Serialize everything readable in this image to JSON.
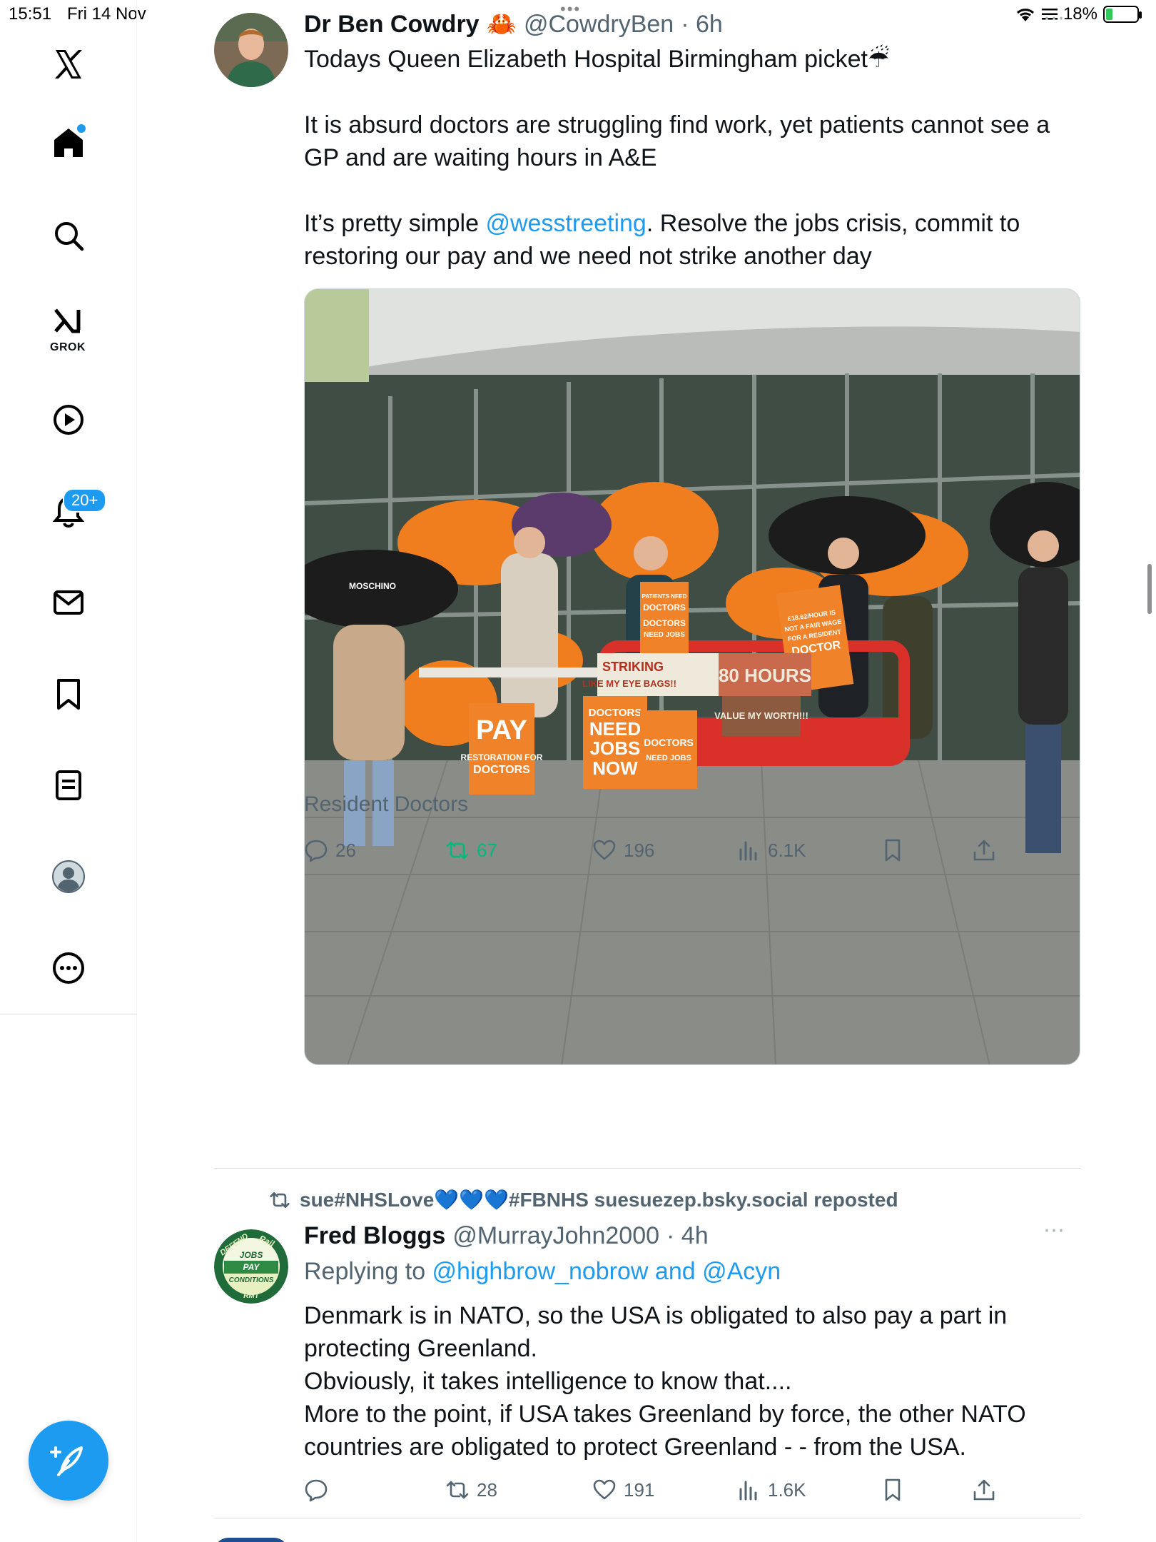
{
  "status_bar": {
    "time": "15:51",
    "date": "Fri 14 Nov",
    "battery": "18%"
  },
  "sidebar": {
    "notifications_badge": "20+",
    "grok_label": "GROK",
    "items": [
      "home-icon",
      "search-icon",
      "grok-icon",
      "video-icon",
      "notifications-icon",
      "messages-icon",
      "bookmarks-icon",
      "lists-icon",
      "profile-icon",
      "more-icon"
    ]
  },
  "tweet1": {
    "name": "Dr Ben Cowdry",
    "emoji": "🦀",
    "handle": "@CowdryBen",
    "time": "· 6h",
    "text_line1": "Todays Queen Elizabeth Hospital Birmingham picket",
    "umbrella": "☔",
    "text_para2": "It is absurd doctors are struggling find work, yet patients cannot see a GP and are waiting hours in A&E",
    "text_para3_pre": "It’s pretty simple ",
    "text_para3_mention": "@wesstreeting",
    "text_para3_post": ". Resolve the jobs crisis, commit to restoring our pay and we need not strike another day",
    "media_caption": "Resident Doctors",
    "media_signs": [
      "PAY",
      "RESTORATION FOR DOCTORS",
      "DOCTORS NEED JOBS NOW",
      "DOCTORS NEED JOBS",
      "PATIENTS NEED DOCTORS",
      "£18.62/HOUR IS NOT A FAIR WAGE FOR A RESIDENT DOCTOR",
      "STRIKING LIKE MY EYE BAGS!!",
      "80 HOURS",
      "VALUE MY WORTH!!!",
      "MOSCHINO"
    ],
    "stats": {
      "replies": "26",
      "reposts": "67",
      "likes": "196",
      "views": "6.1K"
    }
  },
  "tweet2": {
    "reposted_by": "sue#NHSLove💙💙💙#FBNHS suesuezep.bsky.social reposted",
    "name": "Fred Bloggs",
    "handle": "@MurrayJohn2000",
    "time": "· 4h",
    "replying_prefix": "Replying to ",
    "replying_to": "@highbrow_nobrow and @Acyn",
    "avatar_text": [
      "DEFEND",
      "Rail",
      "JOBS",
      "PAY",
      "CONDITIONS",
      "RMT"
    ],
    "text_lines": [
      "Denmark is in NATO, so the USA is obligated to also pay a part in protecting Greenland.",
      "Obviously, it takes intelligence to know that....",
      "More to the point, if USA takes Greenland by force, the other NATO countries are obligated to protect Greenland - - from the USA."
    ],
    "stats": {
      "replies": "",
      "reposts": "28",
      "likes": "191",
      "views": "1.6K"
    }
  },
  "colors": {
    "accent": "#1d9bf0",
    "repost_green": "#00ba7c",
    "muted": "#536471"
  }
}
